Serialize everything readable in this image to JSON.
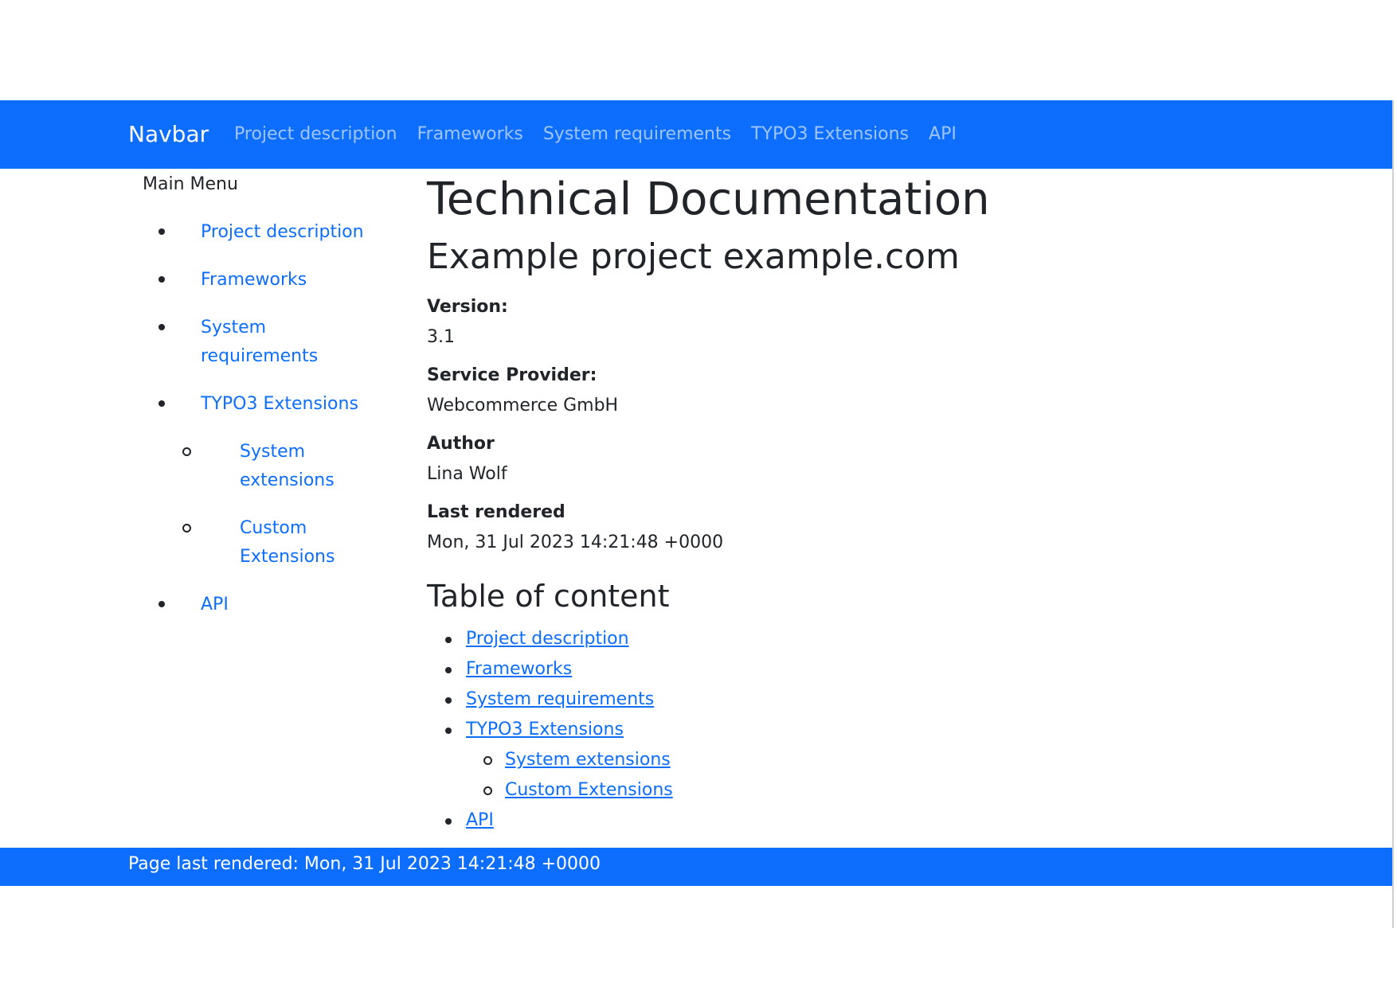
{
  "navbar": {
    "brand": "Navbar",
    "links": [
      "Project description",
      "Frameworks",
      "System requirements",
      "TYPO3 Extensions",
      "API"
    ]
  },
  "sidebar": {
    "title": "Main Menu",
    "items": [
      {
        "label": "Project description"
      },
      {
        "label": "Frameworks"
      },
      {
        "label": "System requirements"
      },
      {
        "label": "TYPO3 Extensions",
        "children": [
          "System extensions",
          "Custom Extensions"
        ]
      },
      {
        "label": "API"
      }
    ]
  },
  "main": {
    "title": "Technical Documentation",
    "subtitle": "Example project example.com",
    "fields": [
      {
        "label": "Version:",
        "value": "3.1"
      },
      {
        "label": "Service Provider:",
        "value": "Webcommerce GmbH"
      },
      {
        "label": "Author",
        "value": "Lina Wolf"
      },
      {
        "label": "Last rendered",
        "value": "Mon, 31 Jul 2023 14:21:48 +0000"
      }
    ],
    "toc_title": "Table of content",
    "toc": [
      {
        "label": "Project description"
      },
      {
        "label": "Frameworks"
      },
      {
        "label": "System requirements"
      },
      {
        "label": "TYPO3 Extensions",
        "children": [
          "System extensions",
          "Custom Extensions"
        ]
      },
      {
        "label": "API"
      }
    ]
  },
  "footer": {
    "text": "Page last rendered: Mon, 31 Jul 2023 14:21:48 +0000"
  },
  "colors": {
    "primary": "#0d6efd",
    "text": "#212529"
  }
}
